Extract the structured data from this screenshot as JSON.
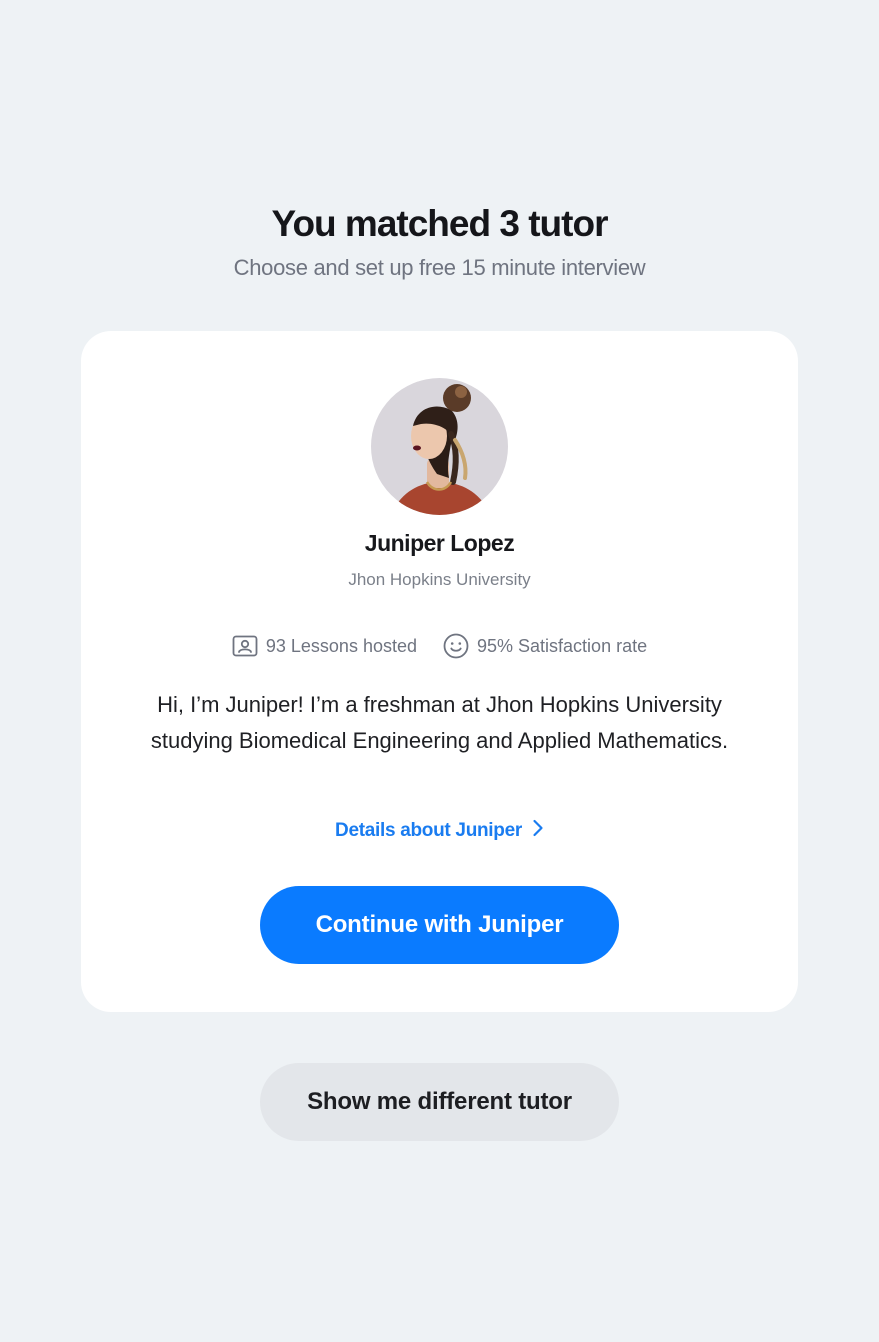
{
  "header": {
    "title": "You matched 3 tutor",
    "subtitle": "Choose and set up free 15 minute interview"
  },
  "tutor": {
    "name": "Juniper Lopez",
    "university": "Jhon Hopkins University",
    "lessons_icon": "profile-card-icon",
    "lessons_label": "93 Lessons hosted",
    "satisfaction_icon": "smiley-icon",
    "satisfaction_label": "95% Satisfaction rate",
    "bio": "Hi, I’m Juniper! I’m a freshman at Jhon Hopkins University studying Biomedical Engineering and Applied Mathematics.",
    "details_label": "Details about Juniper",
    "details_icon": "chevron-right-icon",
    "continue_label": "Continue with Juniper"
  },
  "actions": {
    "different_tutor_label": "Show me different tutor"
  },
  "colors": {
    "background": "#eef2f5",
    "accent": "#0a7bff",
    "link": "#1a7cf0",
    "secondary_button": "#e3e6ea"
  }
}
